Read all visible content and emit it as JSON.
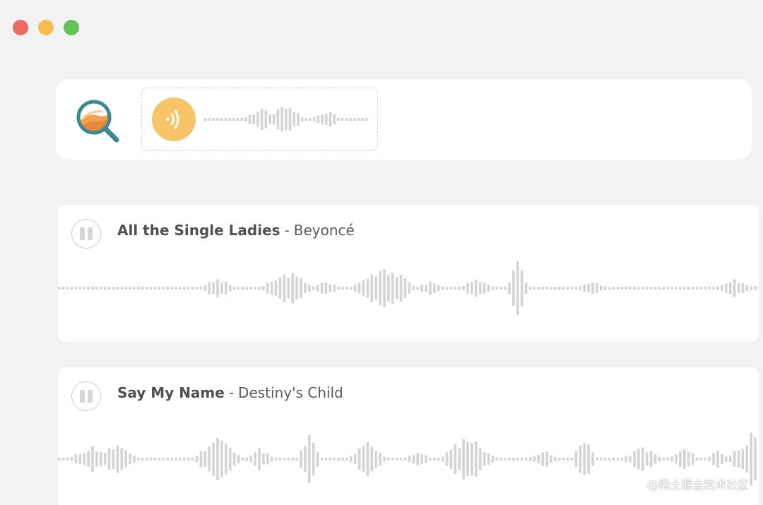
{
  "window": {
    "controls": [
      {
        "name": "close",
        "color": "#ee6a5f"
      },
      {
        "name": "minimize",
        "color": "#f5bd4f"
      },
      {
        "name": "maximize",
        "color": "#61c454"
      }
    ]
  },
  "search": {
    "logo_icon": "magnifier-logo-icon",
    "listen_icon": "sound-wave-listen-icon",
    "accent_color": "#f7c46a"
  },
  "tracks": [
    {
      "song": "All the Single Ladies",
      "separator": "-",
      "artist": "Beyoncé",
      "state": "paused"
    },
    {
      "song": "Say My Name",
      "separator": "-",
      "artist": "Destiny's Child",
      "state": "paused"
    }
  ],
  "watermark": "@稀土掘金技术社区"
}
